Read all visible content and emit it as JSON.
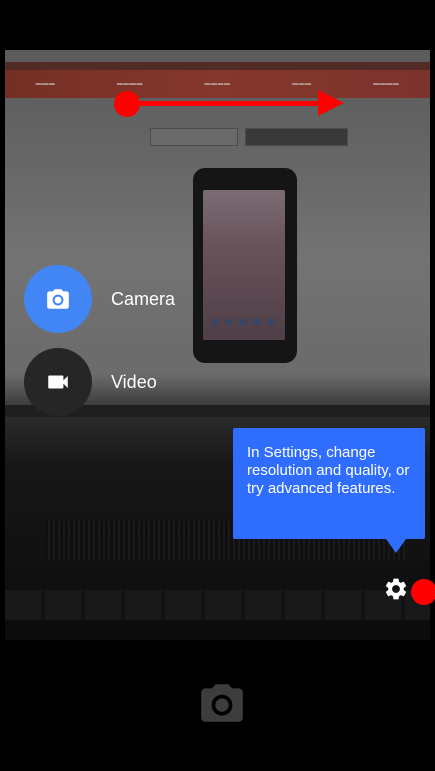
{
  "modes": [
    {
      "label": "Camera",
      "icon": "camera-icon",
      "selected": true
    },
    {
      "label": "Video",
      "icon": "videocam-icon",
      "selected": false
    }
  ],
  "tooltip": {
    "text": "In Settings, change resolution and quality, or try advanced features."
  },
  "settings": {
    "icon": "gear-icon"
  },
  "shutter": {
    "icon": "camera-icon"
  },
  "colors": {
    "accent": "#4285f4",
    "tooltip_bg": "#2f6dff",
    "annotation_red": "#ff0000",
    "mode_inactive_bg": "#262626"
  }
}
